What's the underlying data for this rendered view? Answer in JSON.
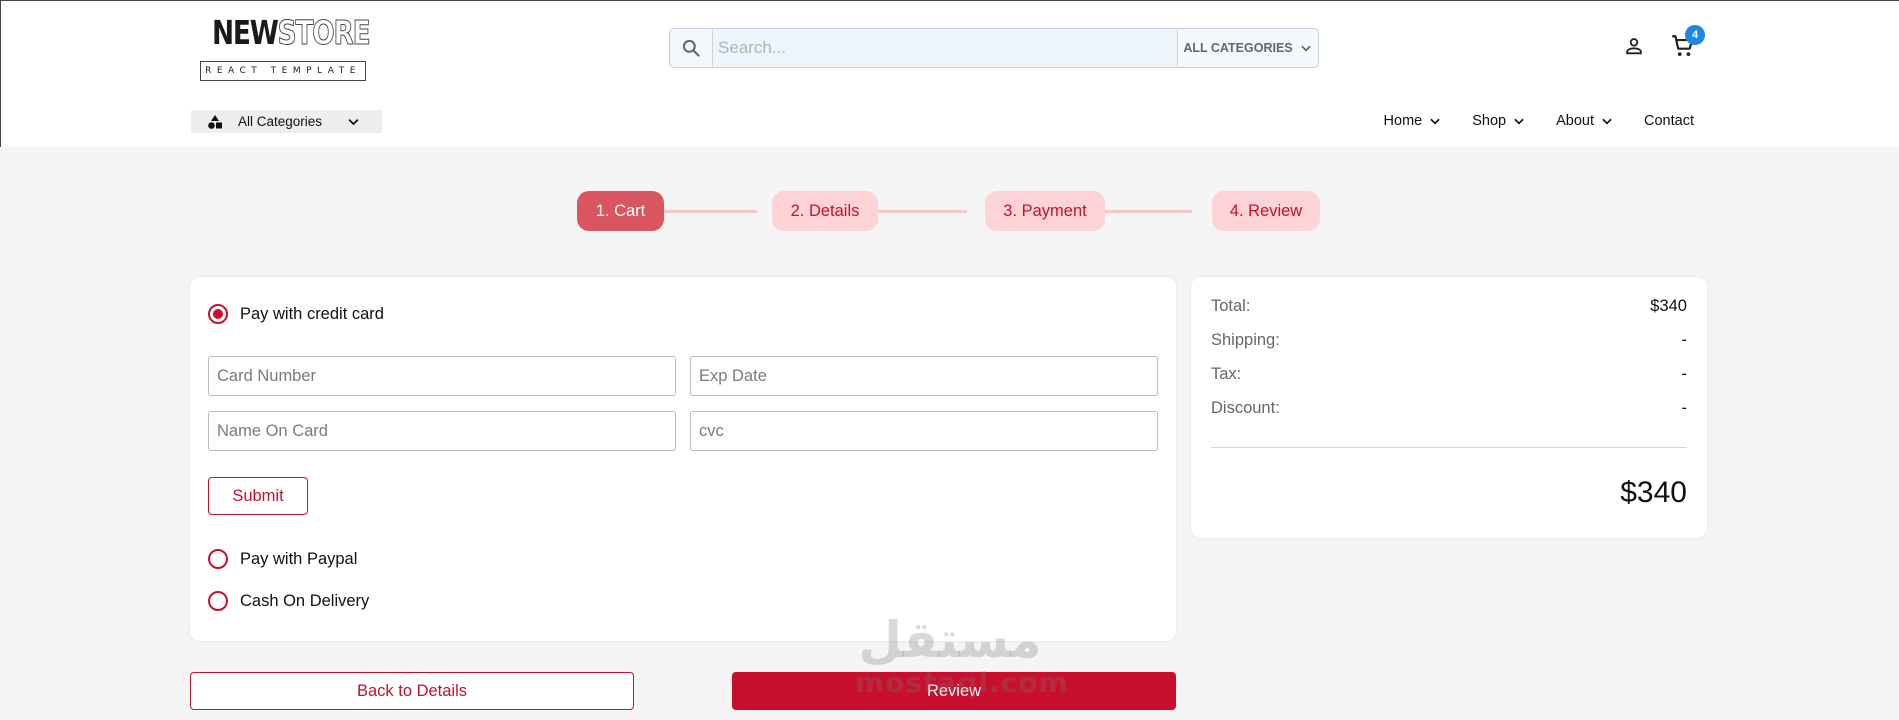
{
  "header": {
    "logo": {
      "word1": "NEW",
      "word2": "STORE",
      "tagline": "REACT TEMPLATE"
    },
    "search": {
      "placeholder": "Search...",
      "category_label": "ALL CATEGORIES"
    },
    "cart_count": "4",
    "icons": {
      "search": "search-icon",
      "user": "user-icon",
      "cart": "cart-icon"
    }
  },
  "subheader": {
    "all_categories_label": "All Categories",
    "nav": [
      {
        "label": "Home",
        "has_dropdown": true
      },
      {
        "label": "Shop",
        "has_dropdown": true
      },
      {
        "label": "About",
        "has_dropdown": true
      },
      {
        "label": "Contact",
        "has_dropdown": false
      }
    ]
  },
  "stepper": {
    "steps": [
      "1. Cart",
      "2. Details",
      "3. Payment",
      "4. Review"
    ],
    "active_index": 0
  },
  "payment": {
    "options": [
      {
        "label": "Pay with credit card",
        "checked": true
      },
      {
        "label": "Pay with Paypal",
        "checked": false
      },
      {
        "label": "Cash On Delivery",
        "checked": false
      }
    ],
    "fields": {
      "card_number": "Card Number",
      "exp_date": "Exp Date",
      "name_on_card": "Name On Card",
      "cvc": "cvc"
    },
    "submit_label": "Submit"
  },
  "summary": {
    "rows": [
      {
        "label": "Total:",
        "value": "$340"
      },
      {
        "label": "Shipping:",
        "value": "-"
      },
      {
        "label": "Tax:",
        "value": "-"
      },
      {
        "label": "Discount:",
        "value": "-"
      }
    ],
    "grand_total": "$340"
  },
  "actions": {
    "back_label": "Back to Details",
    "review_label": "Review"
  },
  "watermark": {
    "arabic": "مستقل",
    "latin": "mostaql.com"
  },
  "colors": {
    "accent": "#c8102e",
    "accent_light": "#fdd3d6",
    "active_step": "#d9555f",
    "badge": "#1e88e5",
    "page_bg": "#f5f5f5"
  }
}
